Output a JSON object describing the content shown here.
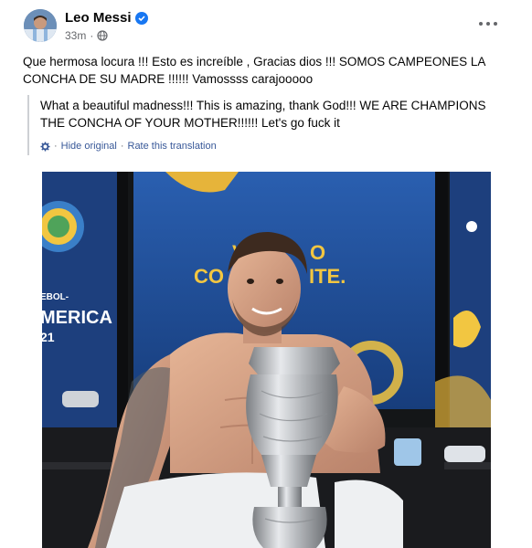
{
  "post": {
    "author": "Leo Messi",
    "time": "33m",
    "privacy_icon": "globe-icon",
    "verified_icon": "verified-badge-icon",
    "more_icon": "more-options-icon",
    "original_text_line1": "Que hermosa locura !!! Esto es increíble , Gracias dios !!! SOMOS CAMPEONES LA",
    "original_text_line2": "CONCHA DE SU MADRE !!!!!! Vamossss carajooooo",
    "translation_line1": "What a beautiful madness!!! This is amazing, thank God!!! WE ARE CHAMPIONS",
    "translation_line2": "THE CONCHA OF YOUR MOTHER!!!!!! Let's go fuck it",
    "translation_settings_icon": "gear-icon",
    "hide_original": "Hide original",
    "rate_translation": "Rate this translation",
    "separator": "·"
  },
  "photo": {
    "wall_text_1": "CO",
    "wall_text_2": "ITE.",
    "wall_text_3": "V",
    "wall_text_4": "O",
    "banner_text_1": "EBOL-",
    "banner_text_2": "MERICA",
    "banner_text_3": "21"
  },
  "colors": {
    "accent": "#1877f2",
    "link": "#385898",
    "secondary_text": "#65676b",
    "locker_blue": "#1f4c9a"
  }
}
